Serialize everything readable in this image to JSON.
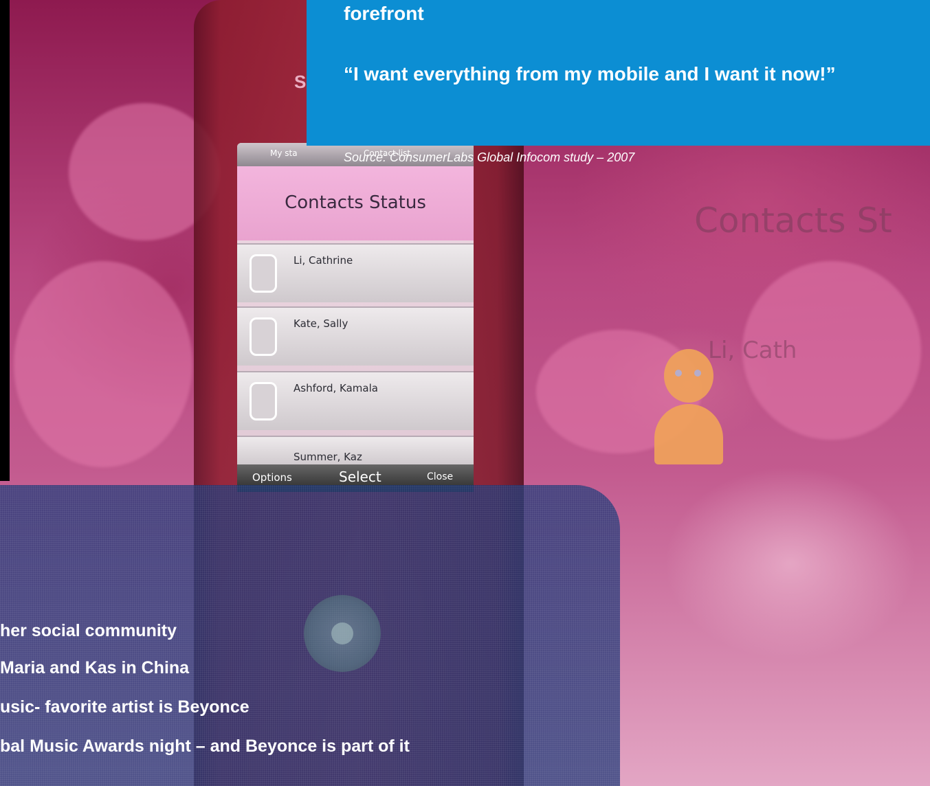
{
  "callout": {
    "line1": "forefront",
    "quote": "“I want everything from my mobile and I want it now!”",
    "source": "Source: ConsumerLabs Global Infocom study – 2007"
  },
  "phone": {
    "tab_left": "My sta",
    "tab_right": "Contact list",
    "screen_title": "Contacts Status",
    "contacts": [
      "Li, Cathrine",
      "Kate, Sally",
      "Ashford, Kamala",
      "Summer, Kaz"
    ],
    "softkeys": {
      "left": "Options",
      "center": "Select",
      "right": "Close"
    },
    "brand_top": "S"
  },
  "background": {
    "ghost_title": "Contacts St",
    "ghost_name": "Li, Cath"
  },
  "panel": {
    "bullets": [
      "her social community",
      "Maria and Kas in China",
      "usic- favorite artist is Beyonce",
      "bal Music Awards night – and Beyonce is part of it"
    ]
  }
}
